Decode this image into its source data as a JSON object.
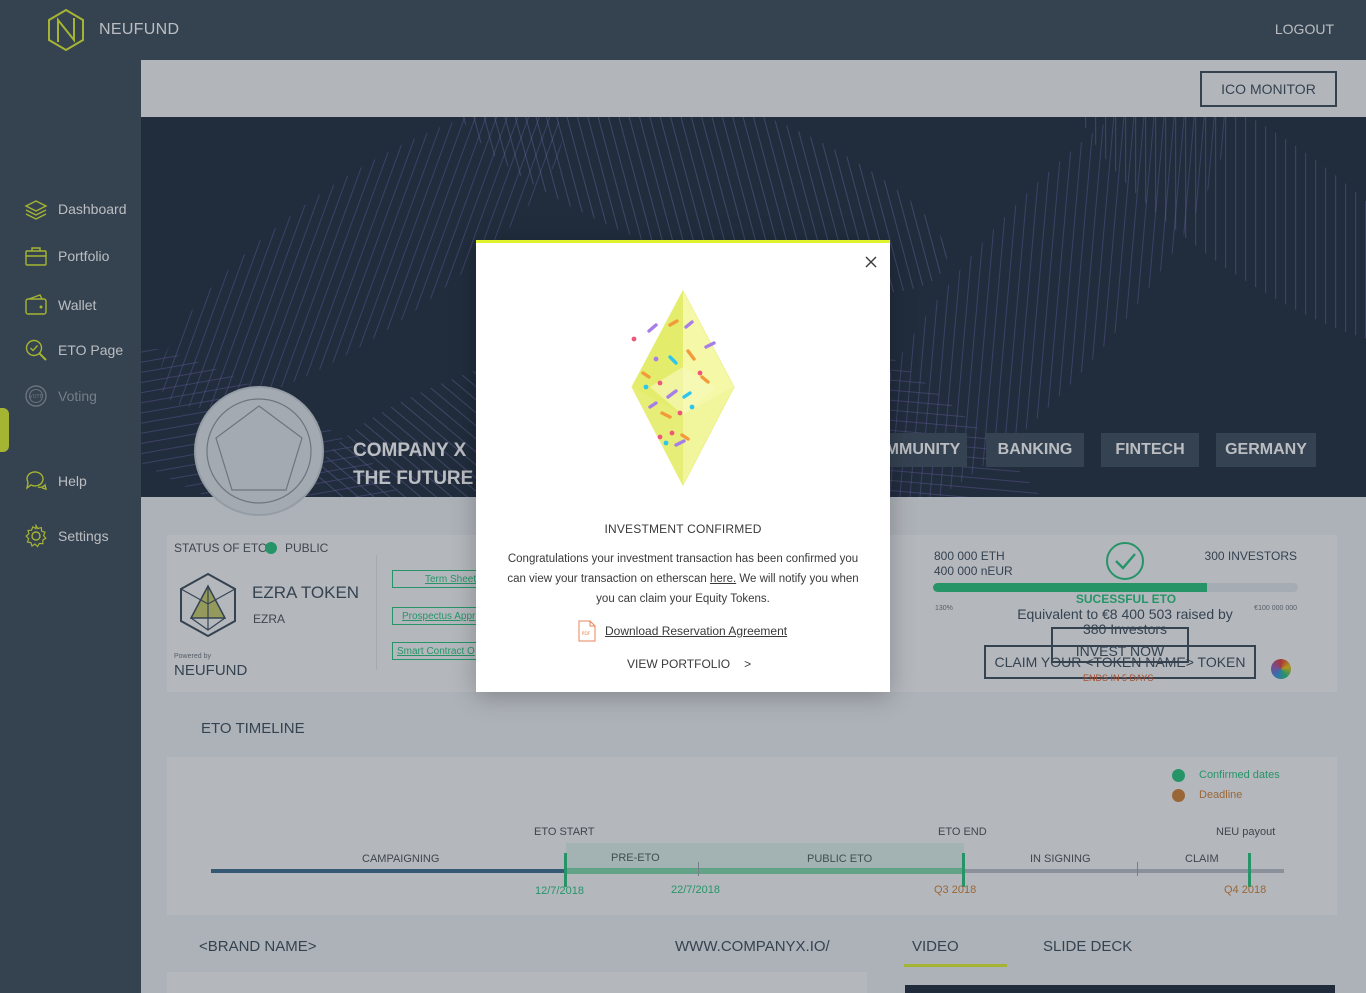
{
  "app": {
    "brand": "NEUFUND",
    "logout_label": "LOGOUT"
  },
  "sidebar": {
    "items": [
      {
        "label": "Dashboard",
        "icon": "layers-icon"
      },
      {
        "label": "Portfolio",
        "icon": "briefcase-icon"
      },
      {
        "label": "Wallet",
        "icon": "wallet-icon"
      },
      {
        "label": "ETO Page",
        "icon": "magnifier-check-icon",
        "active": true
      },
      {
        "label": "Voting",
        "icon": "vote-icon",
        "disabled": true
      },
      {
        "label": "Help",
        "icon": "chat-bubbles-icon"
      },
      {
        "label": "Settings",
        "icon": "gear-icon"
      }
    ]
  },
  "header": {
    "ico_monitor_label": "ICO MONITOR"
  },
  "cover": {
    "company_line1": "COMPANY X",
    "company_line2": "THE FUTURE O",
    "tags": [
      "MMUNITY",
      "BANKING",
      "FINTECH",
      "GERMANY"
    ]
  },
  "eto_card": {
    "status_label": "STATUS OF ETO",
    "status_value": "PUBLIC",
    "token_name": "EZRA TOKEN",
    "token_symbol": "EZRA",
    "powered_by": "Powered by",
    "powered_brand": "NEUFUND",
    "doc_links": [
      "Term Sheet",
      "Prospectus Appr",
      "Smart Contract O"
    ],
    "stats": {
      "eth": "800 000 ETH",
      "neur": "400 000 nEUR",
      "investors": "300 INVESTORS",
      "progress_fraction": 0.75,
      "tiny_left": "130%",
      "tiny_right": "€100 000 000",
      "success_title": "SUCESSFUL ETO",
      "equivalent_line1": "Equivalent to €8 400 503 raised by",
      "equivalent_line2": "380 Investors",
      "invest_now_label": "INVEST NOW",
      "claim_label": "CLAIM YOUR <TOKEN NAME> TOKEN",
      "ends_label": "ENDS IN 5 DAYS"
    }
  },
  "timeline": {
    "title": "ETO TIMELINE",
    "legend": [
      {
        "label": "Confirmed dates",
        "color": "#27c37c"
      },
      {
        "label": "Deadline",
        "color": "#d07f35"
      }
    ],
    "milestones": [
      "ETO START",
      "ETO END",
      "NEU payout"
    ],
    "phases": [
      "CAMPAIGNING",
      "PRE-ETO",
      "PUBLIC ETO",
      "IN SIGNING",
      "CLAIM"
    ],
    "dates": [
      {
        "label": "12/7/2018",
        "color": "#27c37c"
      },
      {
        "label": "22/7/2018",
        "color": "#27c37c"
      },
      {
        "label": "Q3 2018",
        "color": "#d07f35"
      },
      {
        "label": "Q4 2018",
        "color": "#d07f35"
      }
    ]
  },
  "bottom": {
    "brand_name": "<BRAND NAME>",
    "website": "WWW.COMPANYX.IO/",
    "tabs": [
      "VIDEO",
      "SLIDE DECK"
    ]
  },
  "modal": {
    "title": "INVESTMENT CONFIRMED",
    "msg_part1": "Congratulations your investment transaction has been confirmed you can view your transaction on etherscan ",
    "msg_link": "here.",
    "msg_part2": " We will notify you when you can claim your Equity Tokens.",
    "download_label": "Download Reservation Agreement",
    "view_portfolio_label": "VIEW PORTFOLIO",
    "view_portfolio_arrow": ">"
  },
  "colors": {
    "sidebar_bg": "#3b4a59",
    "accent_yellow": "#e1f22e",
    "confirmed_green": "#27c37c",
    "deadline_orange": "#d07f35"
  }
}
